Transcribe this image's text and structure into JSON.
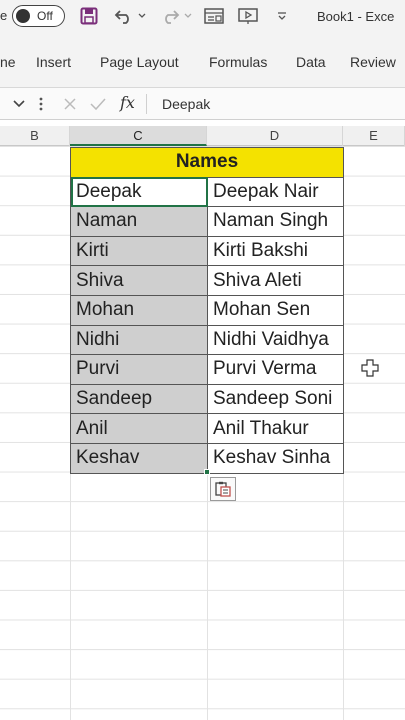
{
  "titlebar": {
    "autosave_prefix": "e",
    "autosave_state": "Off",
    "doc_title": "Book1  -  Exce"
  },
  "ribbon": {
    "tabs": [
      "ne",
      "Insert",
      "Page Layout",
      "Formulas",
      "Data",
      "Review"
    ]
  },
  "formula_bar": {
    "fx_label": "fx",
    "value": "Deepak"
  },
  "columns": [
    "B",
    "C",
    "D",
    "E"
  ],
  "table": {
    "header": "Names",
    "rows": [
      {
        "first": "Deepak",
        "full": "Deepak Nair"
      },
      {
        "first": "Naman",
        "full": "Naman Singh"
      },
      {
        "first": "Kirti",
        "full": "Kirti Bakshi"
      },
      {
        "first": "Shiva",
        "full": "Shiva Aleti"
      },
      {
        "first": "Mohan",
        "full": "Mohan Sen"
      },
      {
        "first": "Nidhi",
        "full": "Nidhi Vaidhya"
      },
      {
        "first": "Purvi",
        "full": "Purvi Verma"
      },
      {
        "first": "Sandeep",
        "full": "Sandeep Soni"
      },
      {
        "first": "Anil",
        "full": "Anil Thakur"
      },
      {
        "first": "Keshav",
        "full": "Keshav Sinha"
      }
    ]
  },
  "colors": {
    "header_fill": "#f4e200",
    "selection_fill": "#cfcfcf",
    "accent": "#217346"
  }
}
